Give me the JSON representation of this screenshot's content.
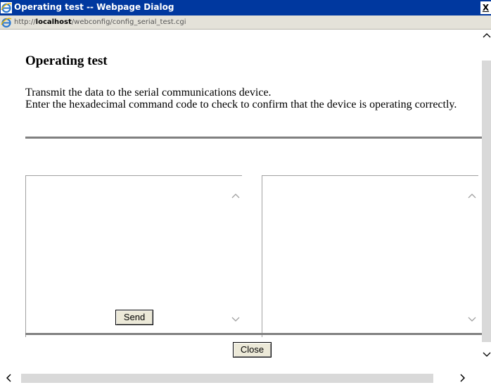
{
  "window": {
    "title": "Operating test -- Webpage Dialog",
    "close_label": "X",
    "url_prefix": "http://",
    "url_host": "localhost",
    "url_path": "/webconfig/config_serial_test.cgi"
  },
  "page": {
    "heading": "Operating test",
    "desc_line1": "Transmit the data to the serial communications device.",
    "desc_line2": "Enter the hexadecimal command code to check to confirm that the device is operating correctly."
  },
  "send_textarea": {
    "value": ""
  },
  "receive_textarea": {
    "value": ""
  },
  "buttons": {
    "send": "Send",
    "close": "Close"
  },
  "icons": {
    "title_icon": "ie-icon",
    "address_icon": "ie-icon",
    "scroll_up": "chevron-up-icon",
    "scroll_down": "chevron-down-icon",
    "scroll_left": "chevron-left-icon",
    "scroll_right": "chevron-right-icon"
  },
  "colors": {
    "titlebar": "#00389f",
    "address_bar": "#e4e2d9",
    "rule": "#808080",
    "button_face": "#ece9d8",
    "scroll_thumb": "#d9d9d9"
  }
}
